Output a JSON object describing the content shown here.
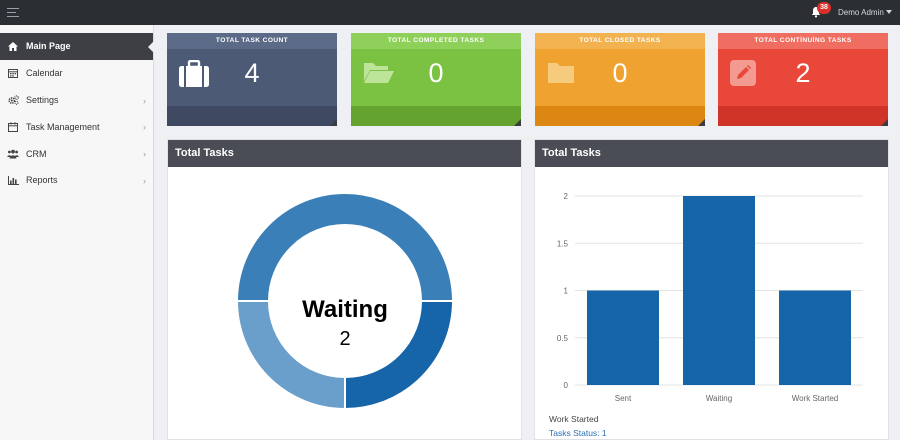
{
  "topbar": {
    "notification_count": "38",
    "user_label": "Demo Admin"
  },
  "sidebar": {
    "items": [
      {
        "label": "Main Page",
        "icon": "home-icon",
        "active": true,
        "has_children": false
      },
      {
        "label": "Calendar",
        "icon": "calendar-icon",
        "active": false,
        "has_children": false
      },
      {
        "label": "Settings",
        "icon": "cogs-icon",
        "active": false,
        "has_children": true
      },
      {
        "label": "Task Management",
        "icon": "calendar-check-icon",
        "active": false,
        "has_children": true
      },
      {
        "label": "CRM",
        "icon": "users-icon",
        "active": false,
        "has_children": true
      },
      {
        "label": "Reports",
        "icon": "bar-chart-icon",
        "active": false,
        "has_children": true
      }
    ]
  },
  "cards": [
    {
      "title": "TOTAL TASK COUNT",
      "value": "4",
      "icon": "briefcase-icon"
    },
    {
      "title": "TOTAL COMPLETED TASKS",
      "value": "0",
      "icon": "folder-open-icon"
    },
    {
      "title": "TOTAL CLOSED TASKS",
      "value": "0",
      "icon": "folder-icon"
    },
    {
      "title": "TOTAL CONTİNUİNG TASKS",
      "value": "2",
      "icon": "edit-icon"
    }
  ],
  "colors": {
    "bar": "#1565a8",
    "donut_segments": [
      "#3a7fb8",
      "#1565a8",
      "#6a9fcb"
    ]
  },
  "donut_panel": {
    "title": "Total Tasks",
    "center_label": "Waiting",
    "center_value": "2"
  },
  "bar_panel": {
    "title": "Total Tasks",
    "legend_label": "Work Started",
    "legend_status": "Tasks Status: 1"
  },
  "chart_data": [
    {
      "type": "pie",
      "categories": [
        "Waiting",
        "Work Started",
        "Sent"
      ],
      "values": [
        2,
        1,
        1
      ]
    },
    {
      "type": "bar",
      "categories": [
        "Sent",
        "Waiting",
        "Work Started"
      ],
      "values": [
        1,
        2,
        1
      ],
      "ylim": [
        0,
        2
      ],
      "yticks": [
        "0",
        "0.5",
        "1",
        "1.5",
        "2"
      ],
      "grid": true
    }
  ]
}
